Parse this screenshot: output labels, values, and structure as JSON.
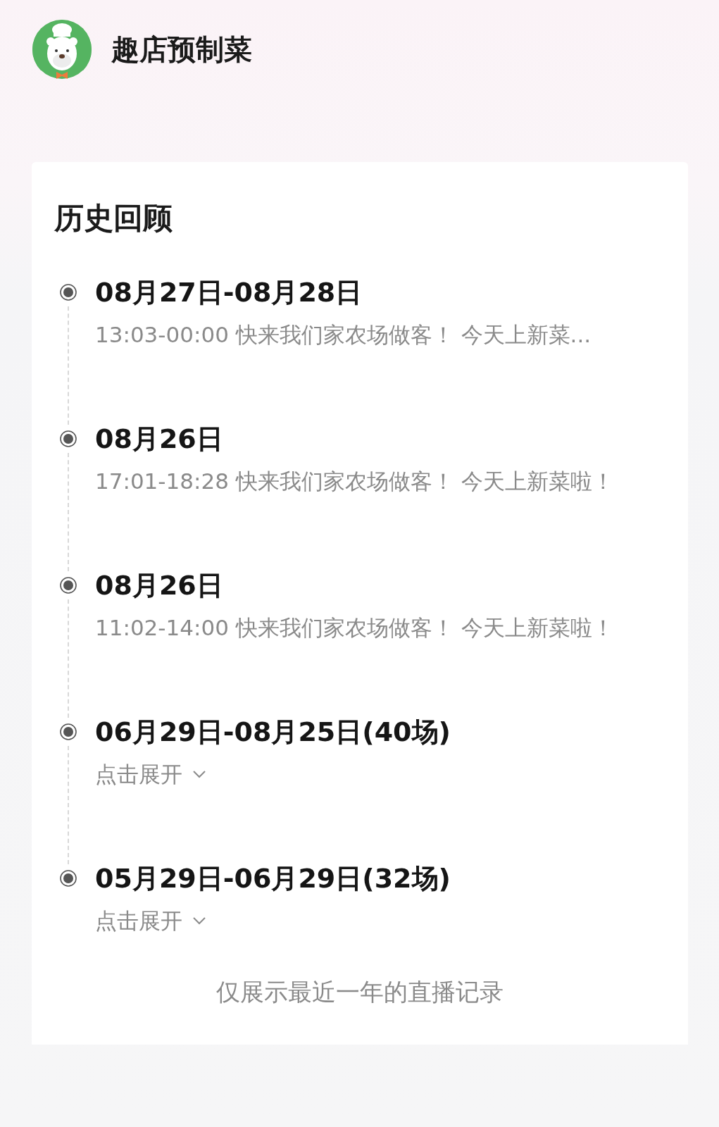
{
  "header": {
    "title": "趣店预制菜"
  },
  "history": {
    "title": "历史回顾",
    "items": [
      {
        "kind": "session",
        "date": "08月27日-08月28日",
        "subtitle": "13:03-00:00 快来我们家农场做客！ 今天上新菜..."
      },
      {
        "kind": "session",
        "date": "08月26日",
        "subtitle": "17:01-18:28 快来我们家农场做客！ 今天上新菜啦！"
      },
      {
        "kind": "session",
        "date": "08月26日",
        "subtitle": "11:02-14:00 快来我们家农场做客！ 今天上新菜啦！"
      },
      {
        "kind": "group",
        "date": "06月29日-08月25日(40场)",
        "expand_label": "点击展开"
      },
      {
        "kind": "group",
        "date": "05月29日-06月29日(32场)",
        "expand_label": "点击展开"
      }
    ],
    "footer": "仅展示最近一年的直播记录"
  }
}
